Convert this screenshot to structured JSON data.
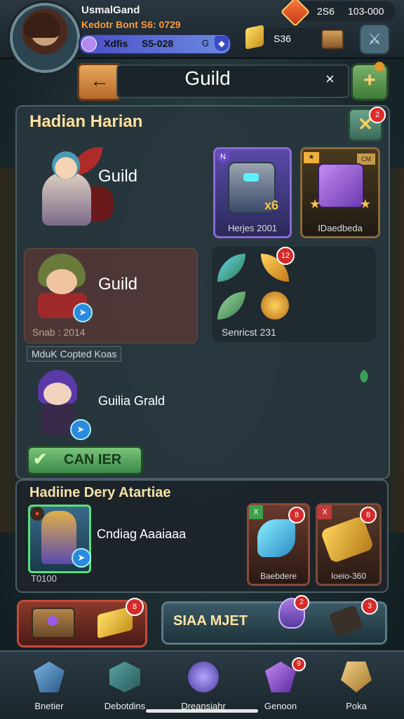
{
  "player": {
    "name": "UsmalGand",
    "subtitle": "Kedotr Bont S6: 0729",
    "xp_label": "Xdfis",
    "xp_value": "S5-028",
    "xp_end": "G"
  },
  "currencies": {
    "gems_a": "2S6",
    "gems_b": "103-000",
    "gold": "S36"
  },
  "header": {
    "title": "Guild",
    "back_glyph": "←",
    "close_glyph": "×"
  },
  "panel1": {
    "title": "Hadian Harian",
    "hero1_label": "Guild",
    "card1_tag": "N",
    "card1_mult": "x6",
    "card1_label": "Herjes 2001",
    "card2_tag": "★",
    "card2_tag2": "CM",
    "card2_label": "IDaedbeda",
    "hero2_label": "Guild",
    "hero2_stat": "Snab : 2014",
    "card3_badge": "12",
    "card3_label": "Senricst 231",
    "copied_label": "MduK Copted Koas",
    "hero3_label": "Guilia Grald",
    "cancel_label": "CAN IER",
    "close_badge": "2"
  },
  "panel2": {
    "title": "Hadiine Dery Atartiae",
    "hero_code": "T0100",
    "hero_name": "Cndiag Aaaiaaa",
    "card1_tag": "X",
    "card1_badge": "8",
    "card1_label": "Baebdere",
    "card2_tag": "X",
    "card2_badge": "8",
    "card2_label": "Ioeio-360"
  },
  "actions": {
    "left_badge": "8",
    "right_label": "SIAA MJET",
    "right_badge1": "2",
    "right_badge2": "3"
  },
  "nav": [
    {
      "label": "Bnetier"
    },
    {
      "label": "Debotdins"
    },
    {
      "label": "Dreansiahr"
    },
    {
      "label": "Genoon",
      "badge": "9"
    },
    {
      "label": "Poka"
    }
  ]
}
